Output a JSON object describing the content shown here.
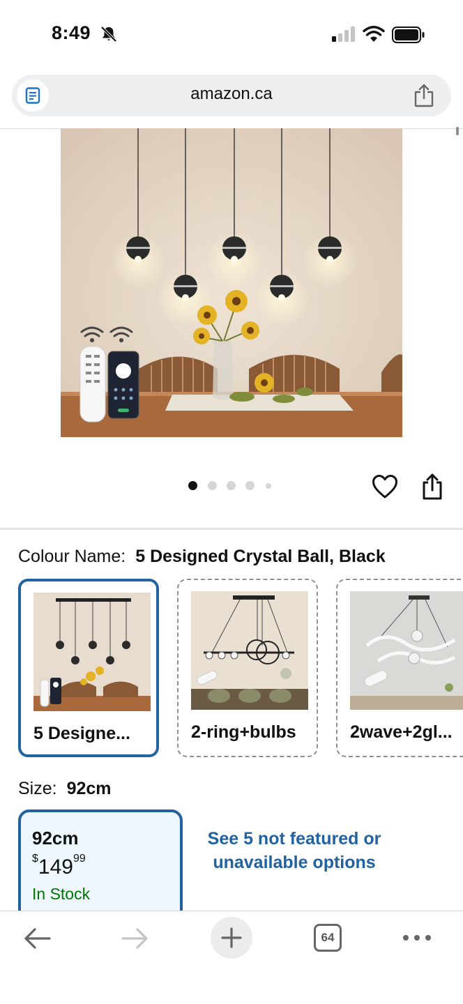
{
  "status_bar": {
    "time": "8:49"
  },
  "browser": {
    "url": "amazon.ca",
    "tab_count": "64"
  },
  "product": {
    "image_count": 5,
    "active_image": 1,
    "colour": {
      "label": "Colour Name:",
      "selected": "5 Designed Crystal Ball, Black",
      "options": [
        {
          "label": "5 Designe..."
        },
        {
          "label": "2-ring+bulbs"
        },
        {
          "label": "2wave+2gl..."
        }
      ]
    },
    "size": {
      "label": "Size:",
      "selected": "92cm",
      "card": {
        "name": "92cm",
        "currency": "$",
        "price_whole": "149",
        "price_fraction": "99",
        "stock": "In Stock"
      },
      "more_link": "See 5 not featured or unavailable options"
    }
  },
  "colors": {
    "accent": "#2162a1",
    "stock_green": "#007600",
    "selected_bg": "#edf7fd"
  }
}
